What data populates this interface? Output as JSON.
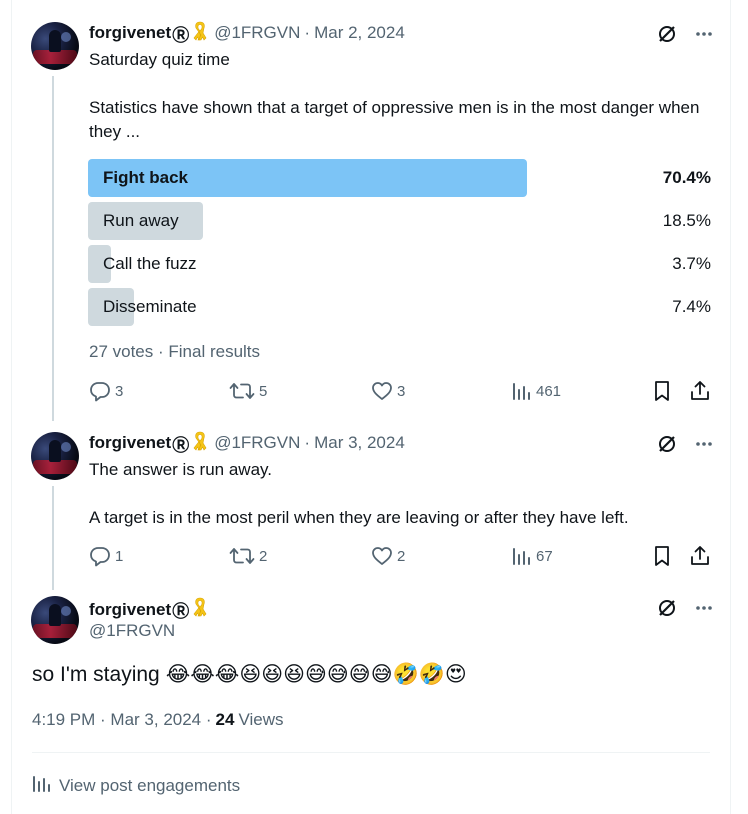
{
  "user": {
    "name": "forgivenet",
    "reg_mark": "Ⓡ",
    "badge": "🎗",
    "handle": "@1FRGVN"
  },
  "tweet1": {
    "date": "Mar 2, 2024",
    "line1": "Saturday quiz time",
    "line2": "Statistics have shown that a target of oppressive men is in the most danger when they ...",
    "poll": {
      "options": [
        {
          "label": "Fight back",
          "pct": "70.4%",
          "fraction": 0.704,
          "winner": true
        },
        {
          "label": "Run away",
          "pct": "18.5%",
          "fraction": 0.185,
          "winner": false
        },
        {
          "label": "Call the fuzz",
          "pct": "3.7%",
          "fraction": 0.037,
          "winner": false
        },
        {
          "label": "Disseminate",
          "pct": "7.4%",
          "fraction": 0.074,
          "winner": false
        }
      ],
      "votes": "27 votes",
      "status": "Final results"
    },
    "stats": {
      "replies": "3",
      "reposts": "5",
      "likes": "3",
      "views": "461"
    }
  },
  "tweet2": {
    "date": "Mar 3, 2024",
    "line1": "The answer is run away.",
    "line2": "A target is in the most peril when they are leaving or after they have left.",
    "stats": {
      "replies": "1",
      "reposts": "2",
      "likes": "2",
      "views": "67"
    }
  },
  "tweet3": {
    "text": "so I'm staying",
    "emojis": "😂😂😂😆😆😆😅😅😅😅🤣🤣😍",
    "time": "4:19 PM",
    "date": "Mar 3, 2024",
    "views_count": "24",
    "views_label": "Views",
    "engagements_label": "View post engagements"
  },
  "colors": {
    "text": "#0f1419",
    "secondary": "#536471",
    "poll_winner": "#7cc4f6",
    "poll_other": "#cfd9de"
  },
  "icons": [
    "grok-icon",
    "more-icon",
    "reply-icon",
    "repost-icon",
    "like-icon",
    "views-icon",
    "bookmark-icon",
    "share-icon",
    "ribbon-icon"
  ]
}
